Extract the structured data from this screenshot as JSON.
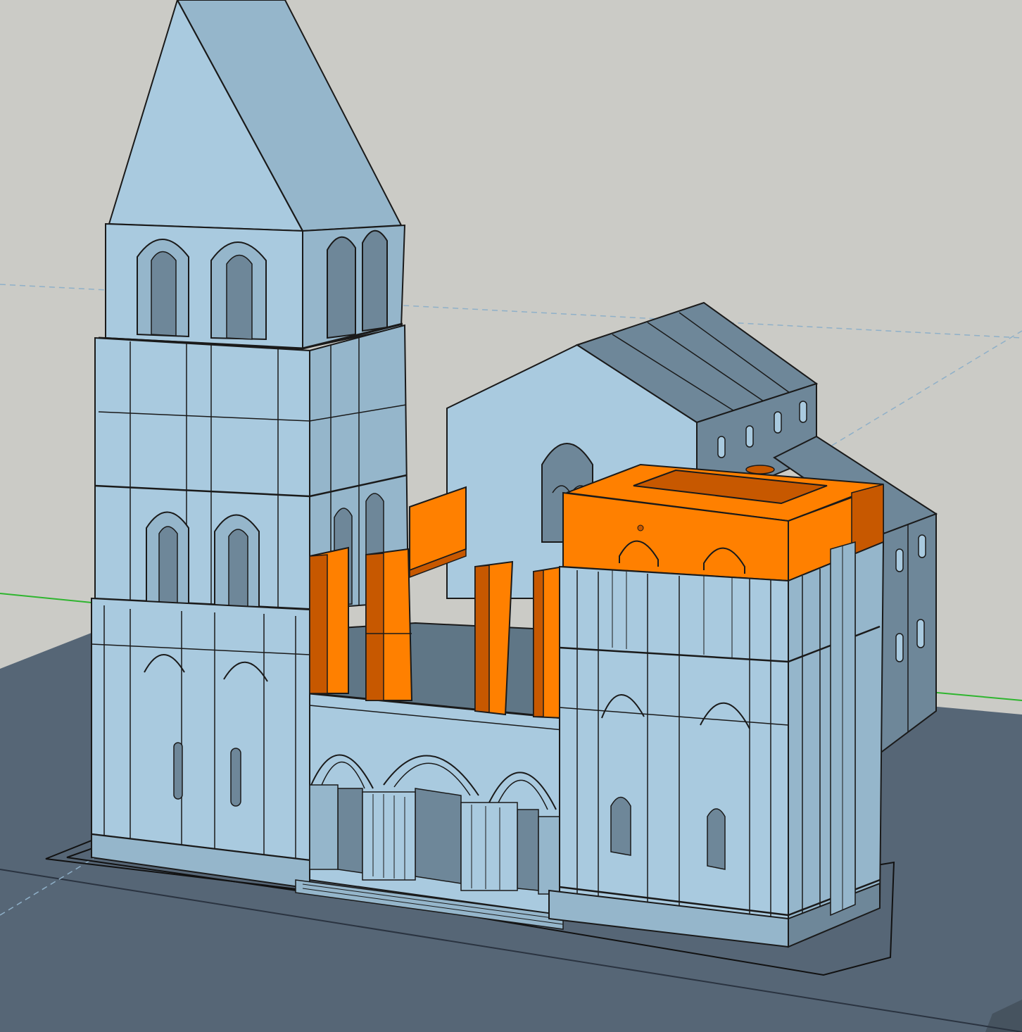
{
  "viewport": {
    "colors": {
      "sky": "#cbcbc6",
      "ground": "#566676",
      "ground_edge": "#46535f",
      "wall_light": "#a9cadf",
      "wall_mid": "#95b6cb",
      "wall_shade": "#6e8799",
      "wall_dark": "#5f7686",
      "highlight": "#ff8000",
      "highlight_dark": "#c75800",
      "stroke": "#1a1a1a",
      "axis_green": "#2fb52f",
      "axis_blue_dashed": "#8fb0c8"
    },
    "objects": {
      "tower": "bell-tower",
      "spire": "spire",
      "nave": "nave",
      "right_block": "right-tower-block",
      "portal": "west-portal",
      "selected": "selected-components"
    }
  }
}
